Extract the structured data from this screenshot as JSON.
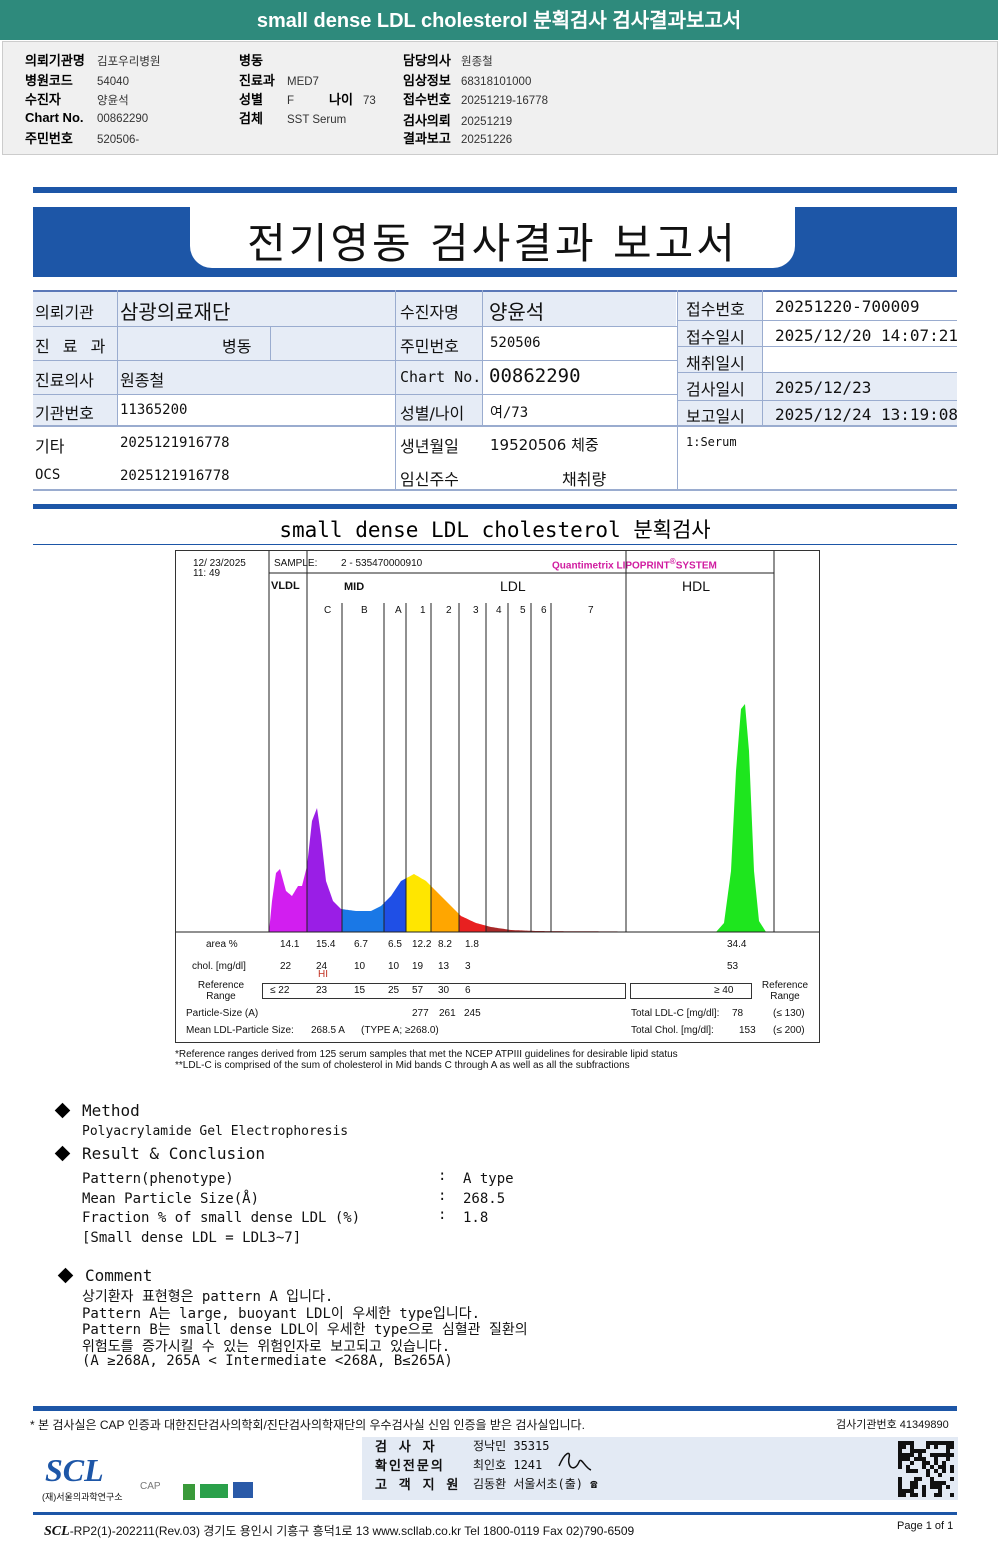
{
  "top_title": "small dense LDL cholesterol 분획검사 검사결과보고서",
  "info": {
    "col1": [
      {
        "label": "의뢰기관명",
        "value": "김포우리병원"
      },
      {
        "label": "병원코드",
        "value": "54040"
      },
      {
        "label": "수진자",
        "value": "양윤석"
      },
      {
        "label": "Chart No.",
        "value": "00862290"
      },
      {
        "label": "주민번호",
        "value": "520506-"
      }
    ],
    "col2": [
      {
        "label": "병동",
        "value": ""
      },
      {
        "label": "진료과",
        "value": "MED7"
      },
      {
        "label": "성별",
        "value": "F"
      },
      {
        "label": "검체",
        "value": "SST Serum"
      }
    ],
    "age_label": "나이",
    "age_value": "73",
    "col3": [
      {
        "label": "담당의사",
        "value": "원종철"
      },
      {
        "label": "임상정보",
        "value": "68318101000"
      },
      {
        "label": "접수번호",
        "value": "20251219-16778"
      },
      {
        "label": "검사의뢰",
        "value": "20251219"
      },
      {
        "label": "결과보고",
        "value": "20251226"
      }
    ]
  },
  "banner_title": "전기영동 검사결과 보고서",
  "report": {
    "l1": "의뢰기관",
    "v1": "삼광의료재단",
    "l2": "수진자명",
    "v2": "양윤석",
    "l3": "접수번호",
    "v3": "20251220-700009",
    "l4": "진 료 과",
    "v4": "병동",
    "l5": "주민번호",
    "v5": "520506",
    "l6": "접수일시",
    "v6": "2025/12/20 14:07:21",
    "l7": "채취일시",
    "v7": "",
    "l8": "진료의사",
    "v8": "원종철",
    "l9": "Chart No.",
    "v9": "00862290",
    "l10": "검사일시",
    "v10": "2025/12/23",
    "l11": "기관번호",
    "v11": "11365200",
    "l12": "성별/나이",
    "v12": "여/73",
    "l13": "보고일시",
    "v13": "2025/12/24 13:19:08",
    "l14": "기타",
    "v14": "2025121916778",
    "l15": "생년월일",
    "v15": "19520506 체중",
    "v16": "1:Serum",
    "l17": "OCS",
    "v17": "2025121916778",
    "l18": "임신주수",
    "v18": "채취량"
  },
  "section_title": "small dense LDL cholesterol 분획검사",
  "chart": {
    "datetime1": "12/ 23/2025",
    "datetime2": "11: 49",
    "sample_label": "SAMPLE:",
    "sample_value": "2 - 535470000910",
    "brand": "Quantimetrix LIPOPRINT",
    "brand_suffix": "SYSTEM",
    "brand_color": "#d01ca0",
    "groups": {
      "vldl": "VLDL",
      "mid": "MID",
      "ldl": "LDL",
      "hdl": "HDL"
    },
    "bands": [
      "C",
      "B",
      "A",
      "1",
      "2",
      "3",
      "4",
      "5",
      "6",
      "7"
    ],
    "area_label": "area %",
    "chol_label": "chol. [mg/dl]",
    "hi_label": "HI",
    "ref_label": "Reference Range",
    "ref_label_right": "Reference Range",
    "columns": [
      "VLDL",
      "MID C",
      "MID B",
      "MID A",
      "LDL1",
      "LDL2",
      "LDL3-7",
      "HDL"
    ],
    "area": [
      "14.1",
      "15.4",
      "6.7",
      "6.5",
      "12.2",
      "8.2",
      "1.8",
      "34.4"
    ],
    "chol": [
      "22",
      "24",
      "10",
      "10",
      "19",
      "13",
      "3",
      "53"
    ],
    "ref": [
      "≤ 22",
      "23",
      "15",
      "25",
      "57",
      "30",
      "6"
    ],
    "ref_hdl": "≥  40",
    "particle_label": "Particle-Size (A)",
    "particle": [
      "277",
      "261",
      "245"
    ],
    "mean_label": "Mean LDL-Particle Size:",
    "mean_value": "268.5  A",
    "mean_type": "(TYPE A; ≥268.0)",
    "total_ldl_label": "Total LDL-C  [mg/dl]:",
    "total_ldl": "78",
    "total_ldl_ref": "(≤ 130)",
    "total_chol_label": "Total Chol.  [mg/dl]:",
    "total_chol": "153",
    "total_chol_ref": "(≤ 200)",
    "colors": {
      "vldl": "#d21ef0",
      "c": "#9a1ee6",
      "b": "#1a78e6",
      "a": "#1f4fe6",
      "l1": "#ffe600",
      "l2": "#ffa600",
      "l3": "#e82020",
      "l47": "#a82828",
      "hdl": "#1ee61e"
    },
    "note1": "*Reference ranges derived from 125 serum samples that met the NCEP ATPIII guidelines for desirable lipid status",
    "note2": "**LDL-C is comprised of the sum of cholesterol in Mid bands C through A as well as all the subfractions"
  },
  "method": {
    "title": "Method",
    "text": "Polyacrylamide Gel Electrophoresis"
  },
  "result": {
    "title": "Result & Conclusion",
    "rows": [
      {
        "label": "Pattern(phenotype)",
        "value": "A type"
      },
      {
        "label": "Mean Particle Size(Å)",
        "value": "268.5"
      },
      {
        "label": "Fraction % of small dense LDL (%)",
        "value": "1.8"
      }
    ],
    "note": "[Small dense LDL = LDL3~7]",
    "colon": ":"
  },
  "comment": {
    "title": "Comment",
    "lines": [
      "상기환자 표현형은 pattern A 입니다.",
      "Pattern A는 large, buoyant LDL이 우세한 type입니다.",
      "Pattern B는 small dense LDL이 우세한 type으로 심혈관 질환의",
      "위험도를 증가시킬 수 있는 위험인자로 보고되고 있습니다.",
      "(A ≥268A, 265A < Intermediate <268A, B≤265A)"
    ]
  },
  "footer": {
    "cert": "* 본 검사실은 CAP 인증과 대한진단검사의학회/진단검사의학재단의 우수검사실 신임 인증을 받은 검사실입니다.",
    "lab_no": "검사기관번호 41349890",
    "tester_label": "검  사  자",
    "tester": "정낙민 35315",
    "confirm_label": "확인전문의",
    "confirm": "최인호 1241",
    "support_label": "고 객 지 원",
    "support": "김동환 서울서초(출) ☎",
    "logo": "SCL",
    "logo_sub": "(재)서울의과학연구소",
    "cap": "CAP",
    "address_prefix": "SCL",
    "address": "-RP2(1)-202211(Rev.03)  경기도 용인시 기흥구 흥덕1로 13  www.scllab.co.kr  Tel 1800-0119  Fax 02)790-6509",
    "page": "Page 1 of 1"
  }
}
